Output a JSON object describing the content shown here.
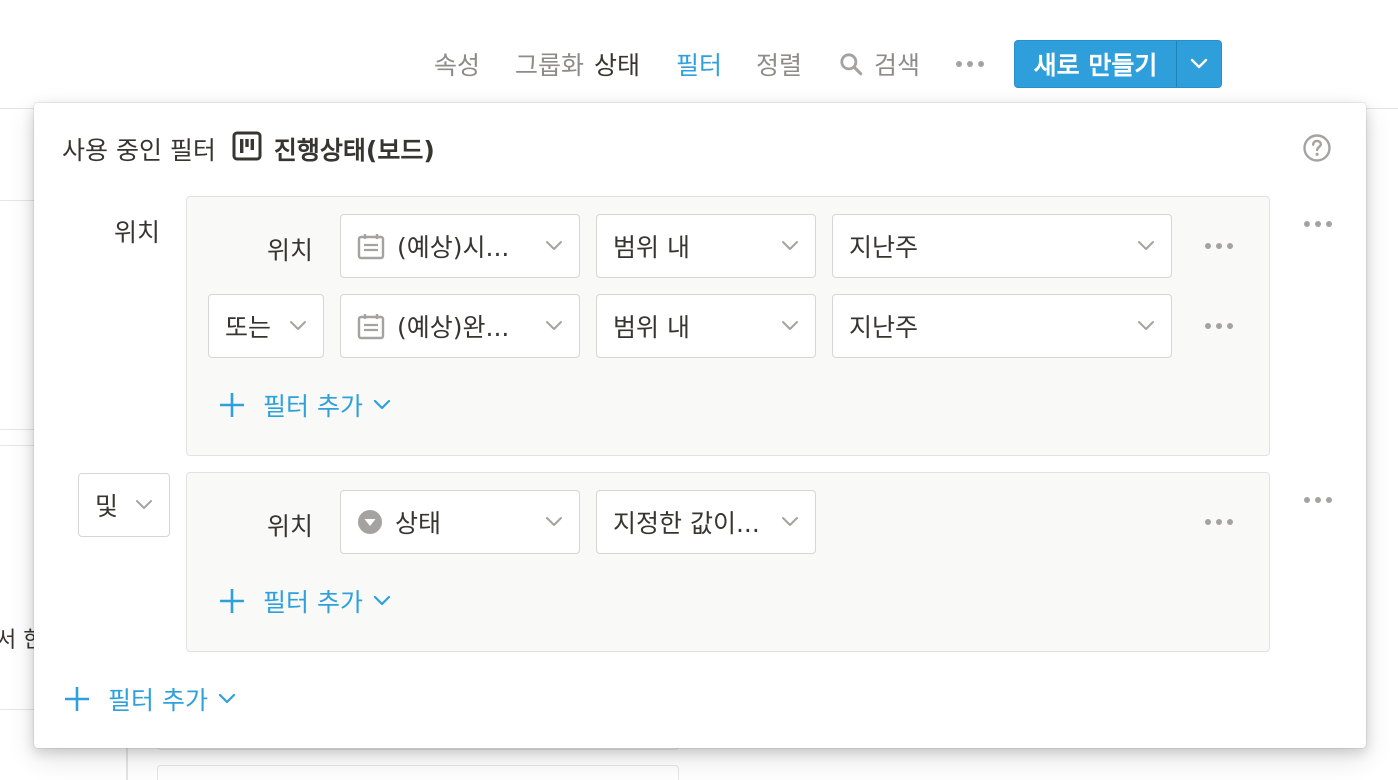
{
  "toolbar": {
    "properties": "속성",
    "group_label": "그룹화",
    "group_value": "상태",
    "filter": "필터",
    "sort": "정렬",
    "search": "검색",
    "new_button": "새로 만들기"
  },
  "background": {
    "partial_text": "서 한"
  },
  "popup": {
    "active_label": "사용 중인 필터",
    "view_name": "진행상태(보드)",
    "groups": [
      {
        "outer_label": "위치",
        "rows": [
          {
            "conjunction": "위치",
            "property": "(예상)시...",
            "operator": "범위 내",
            "value": "지난주"
          },
          {
            "conjunction": "또는",
            "property": "(예상)완...",
            "operator": "범위 내",
            "value": "지난주"
          }
        ],
        "add_filter": "필터 추가"
      },
      {
        "outer_label": "및",
        "rows": [
          {
            "conjunction": "위치",
            "property": "상태",
            "operator": "지정한 값이..."
          }
        ],
        "add_filter": "필터 추가"
      }
    ],
    "add_filter": "필터 추가"
  },
  "colors": {
    "accent": "#2ea0dc",
    "button": "#2e9fdb",
    "text": "#37352f",
    "muted": "#8e8c87"
  },
  "icons": {
    "search": "search-icon",
    "more": "more-horizontal-icon",
    "board": "board-icon",
    "help": "help-circle-icon",
    "date": "calendar-icon",
    "select": "select-property-icon",
    "chevron": "chevron-down-icon",
    "plus": "plus-icon"
  }
}
